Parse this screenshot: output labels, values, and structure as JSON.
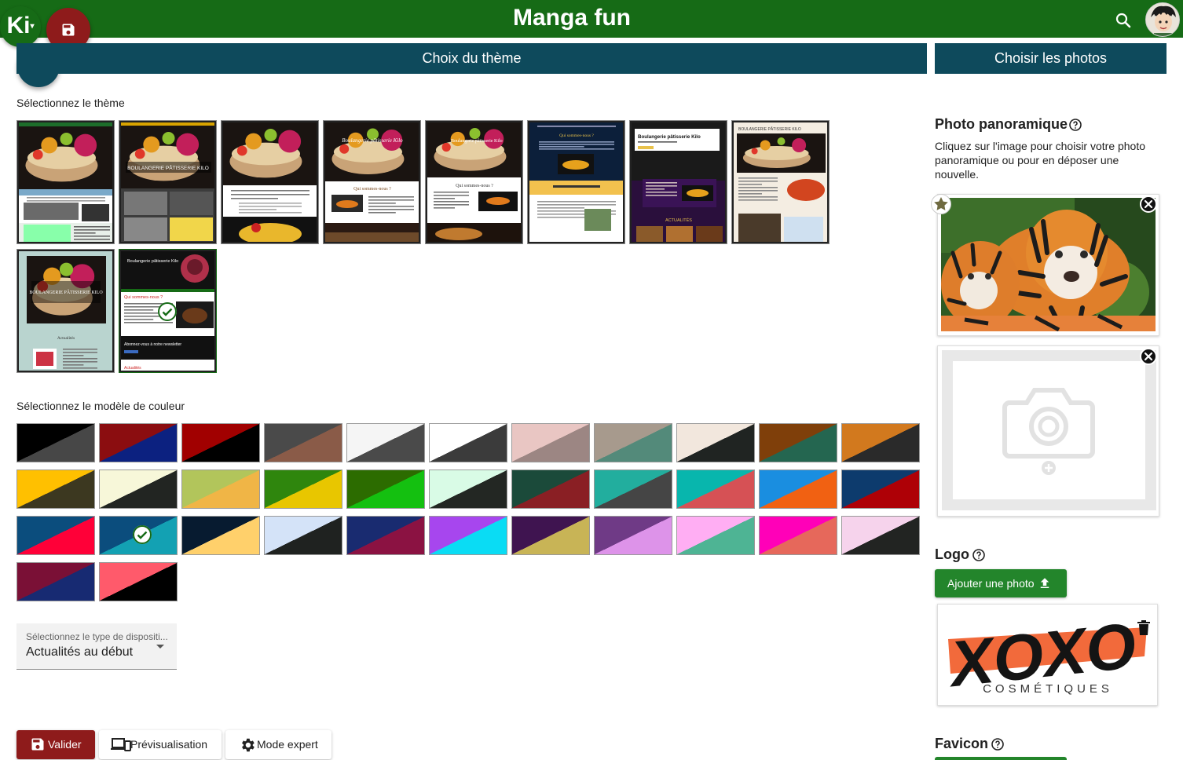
{
  "app": {
    "title": "Manga fun",
    "logo_text": "Ki",
    "logo_caret": "▾"
  },
  "tabs": [
    {
      "label": "Choix du thème"
    },
    {
      "label": "Choisir les photos"
    }
  ],
  "theme_section": {
    "label": "Sélectionnez le thème",
    "themes": [
      {
        "name": "Theme 1"
      },
      {
        "name": "Theme 2"
      },
      {
        "name": "Theme 3"
      },
      {
        "name": "Theme 4"
      },
      {
        "name": "Theme 5"
      },
      {
        "name": "Theme 6"
      },
      {
        "name": "Theme 7"
      },
      {
        "name": "Theme 8"
      },
      {
        "name": "Theme 9"
      },
      {
        "name": "Theme 10",
        "selected": true
      }
    ],
    "thumbnail_titles": {
      "t2": "BOULANGERIE PÂTISSERIE KILO",
      "t4": "Boulangerie pâtisserie Kilo",
      "t5": "Boulangerie pâtisserie Kilo",
      "t7": "Boulangerie pâtisserie Kilo",
      "t8": "BOULANGERIE PÂTISSERIE KILO",
      "t9": "BOULANGERIE PÂTISSERIE KILO",
      "t4_sub": "Qui sommes-nous ?",
      "t10_sub": "Qui sommes-nous ?",
      "t10_news": "Abonnez-vous à notre newsletter",
      "t10_act": "Actualités",
      "t7_act": "ACTUALITÉS",
      "t9_act": "Actualités"
    }
  },
  "color_section": {
    "label": "Sélectionnez le modèle de couleur",
    "palettes": [
      {
        "a": "#000000",
        "b": "#474747"
      },
      {
        "a": "#8b0d10",
        "b": "#0c2180"
      },
      {
        "a": "#a10000",
        "b": "#000000"
      },
      {
        "a": "#4a4a4a",
        "b": "#8a5b48"
      },
      {
        "a": "#f5f5f5",
        "b": "#4a4a4a"
      },
      {
        "a": "#ffffff",
        "b": "#3b3b3b"
      },
      {
        "a": "#e9c6c3",
        "b": "#9c8683"
      },
      {
        "a": "#a79a8d",
        "b": "#538a7a"
      },
      {
        "a": "#f2e7dd",
        "b": "#202422"
      },
      {
        "a": "#7f3f0a",
        "b": "#246650"
      },
      {
        "a": "#d2791e",
        "b": "#2a2a2a"
      },
      {
        "a": "#ffc000",
        "b": "#3c3820"
      },
      {
        "a": "#f7f7d9",
        "b": "#222522"
      },
      {
        "a": "#b2c55b",
        "b": "#f0b546"
      },
      {
        "a": "#2f860d",
        "b": "#e8c600"
      },
      {
        "a": "#2c6c00",
        "b": "#14c010"
      },
      {
        "a": "#d9fbe6",
        "b": "#232723"
      },
      {
        "a": "#1b4a3a",
        "b": "#8a1f24"
      },
      {
        "a": "#22ae9e",
        "b": "#454545"
      },
      {
        "a": "#08b6ad",
        "b": "#d65155"
      },
      {
        "a": "#1a8ee0",
        "b": "#f16112"
      },
      {
        "a": "#0d3b6d",
        "b": "#ae0006"
      },
      {
        "a": "#0b4d7d",
        "b": "#ff0038"
      },
      {
        "a": "#0b4d7d",
        "b": "#13a1b3",
        "selected": true
      },
      {
        "a": "#071b30",
        "b": "#ffd06b"
      },
      {
        "a": "#d4e3f8",
        "b": "#1f2220"
      },
      {
        "a": "#192b70",
        "b": "#8b1242"
      },
      {
        "a": "#a746ee",
        "b": "#0adcf4"
      },
      {
        "a": "#3f1450",
        "b": "#c8b456"
      },
      {
        "a": "#6f3a86",
        "b": "#dd93e9"
      },
      {
        "a": "#ffaef3",
        "b": "#4eb494"
      },
      {
        "a": "#ff00b8",
        "b": "#e6685b"
      },
      {
        "a": "#f6d3ec",
        "b": "#222422"
      },
      {
        "a": "#7a1036",
        "b": "#172a72"
      },
      {
        "a": "#ff5a6b",
        "b": "#000000"
      }
    ]
  },
  "layout_select": {
    "label": "Sélectionnez le type de dispositi...",
    "value": "Actualités au début"
  },
  "actions": {
    "validate": "Valider",
    "preview": "Prévisualisation",
    "expert": "Mode expert"
  },
  "right_panel": {
    "panorama_heading": "Photo panoramique",
    "panorama_desc": "Cliquez sur l'image pour choisir votre photo panoramique ou pour en déposer une nouvelle.",
    "logo_heading": "Logo",
    "add_photo": "Ajouter une photo",
    "logo_word": "XOXO",
    "logo_sub": "COSMÉTIQUES",
    "favicon_heading": "Favicon"
  },
  "colors": {
    "primary_green": "#166b16",
    "accent_teal": "#0e4a5c",
    "danger_red": "#8e1b1b",
    "button_green": "#23852b"
  }
}
